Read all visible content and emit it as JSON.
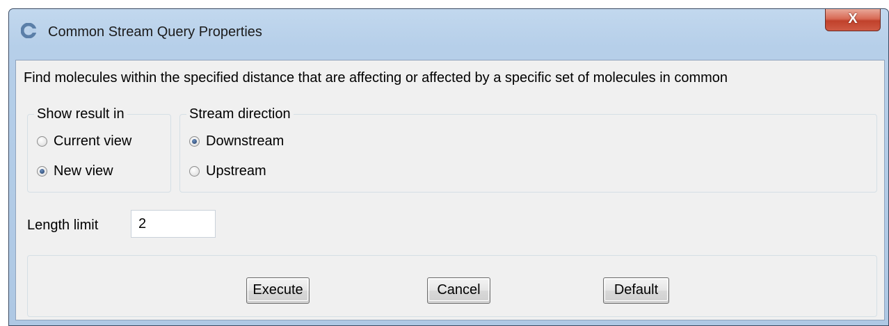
{
  "window": {
    "title": "Common Stream Query Properties",
    "close_label": "X",
    "icon": "app-c-icon",
    "accent": "#aec8e4"
  },
  "description": "Find molecules within the specified distance that are affecting or affected by a specific set of molecules in common",
  "show_result": {
    "legend": "Show result in",
    "options": [
      {
        "label": "Current view",
        "checked": false
      },
      {
        "label": "New view",
        "checked": true
      }
    ]
  },
  "stream_direction": {
    "legend": "Stream direction",
    "options": [
      {
        "label": "Downstream",
        "checked": true
      },
      {
        "label": "Upstream",
        "checked": false
      }
    ]
  },
  "length_limit": {
    "label": "Length limit",
    "value": "2"
  },
  "buttons": {
    "execute": "Execute",
    "cancel": "Cancel",
    "default": "Default"
  }
}
